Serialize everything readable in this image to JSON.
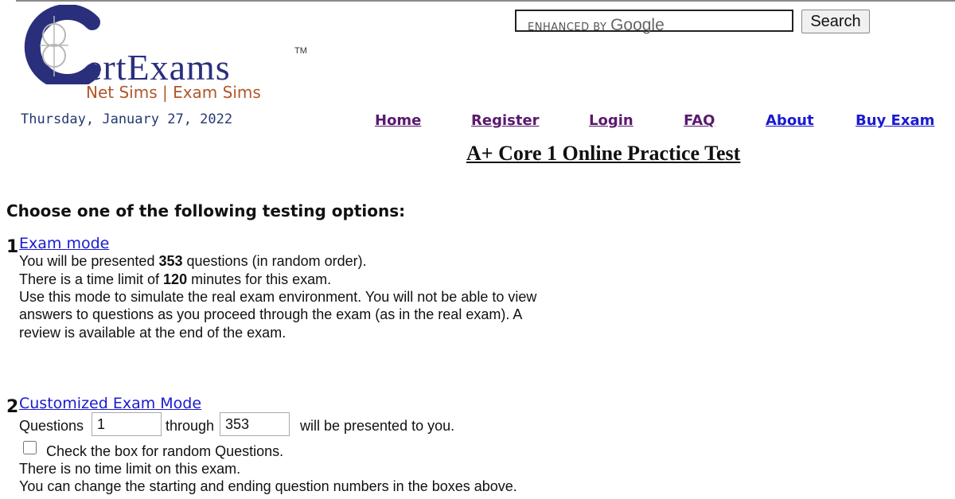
{
  "logo": {
    "wordmark": "ertExams",
    "trademark": "TM",
    "tagline": "Net Sims | Exam Sims"
  },
  "search": {
    "placeholder_prefix": "ENHANCED BY",
    "placeholder_brand": "Google",
    "value": "",
    "button_label": "Search"
  },
  "date": "Thursday, January 27, 2022",
  "nav": {
    "home": "Home",
    "register": "Register",
    "login": "Login",
    "faq": "FAQ",
    "about": "About",
    "buy_exam": "Buy Exam"
  },
  "page_title": "A+ Core 1 Online Practice Test",
  "choose_heading": "Choose one of the following testing options:",
  "option1": {
    "number": "1",
    "link": "Exam mode",
    "line1_pre": "You will be presented ",
    "question_count": "353",
    "line1_post": " questions (in random order).",
    "line2_pre": "There is a time limit of ",
    "time_limit": "120",
    "line2_post": " minutes for this exam.",
    "line3": "Use this mode to simulate the real exam environment. You will not be able to view",
    "line4": "answers to questions as you proceed through the exam (as in the real exam). A",
    "line5": "review is available at the end of the exam."
  },
  "option2": {
    "number": "2",
    "link": "Customized Exam Mode",
    "questions_label": "Questions",
    "start_value": "1",
    "through_label": "through",
    "end_value": "353",
    "presented_label": "will be presented to you.",
    "random_label": "Check the box for random Questions.",
    "random_checked": false,
    "line_no_time": "There is no time limit on this exam.",
    "line_change": "You can change the starting and ending question numbers in the boxes above."
  }
}
